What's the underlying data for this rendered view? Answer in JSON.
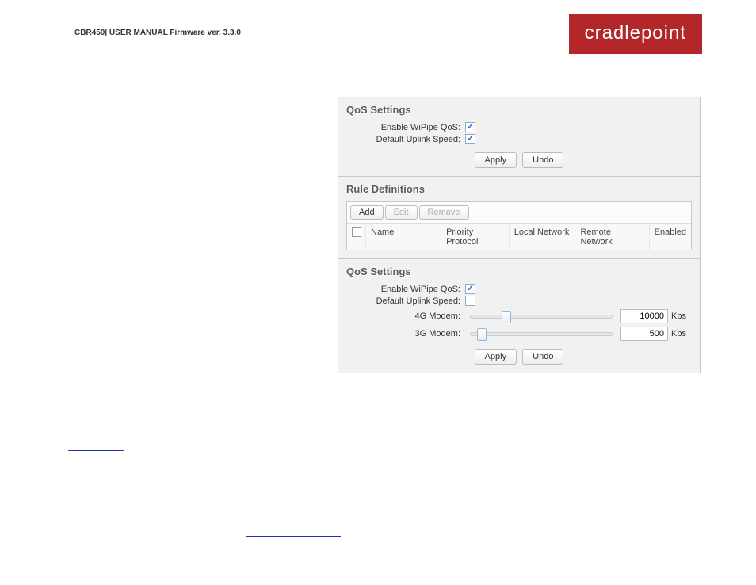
{
  "header": {
    "doc_title": "CBR450| USER MANUAL Firmware ver. 3.3.0",
    "logo_text": "cradlepoint"
  },
  "panel1": {
    "title": "QoS Settings",
    "enable_label": "Enable WiPipe QoS:",
    "default_label": "Default Uplink Speed:",
    "enable_checked": true,
    "default_checked": true,
    "apply_label": "Apply",
    "undo_label": "Undo"
  },
  "rules": {
    "title": "Rule Definitions",
    "add_label": "Add",
    "edit_label": "Edit",
    "remove_label": "Remove",
    "columns": {
      "name": "Name",
      "priority": "Priority Protocol",
      "local": "Local Network",
      "remote": "Remote Network",
      "enabled": "Enabled"
    }
  },
  "panel2": {
    "title": "QoS Settings",
    "enable_label": "Enable WiPipe QoS:",
    "default_label": "Default Uplink Speed:",
    "enable_checked": true,
    "default_checked": false,
    "modem4g_label": "4G Modem:",
    "modem4g_value": "10000",
    "modem4g_thumb_pct": 22,
    "modem3g_label": "3G Modem:",
    "modem3g_value": "500",
    "modem3g_thumb_pct": 5,
    "unit": "Kbs",
    "apply_label": "Apply",
    "undo_label": "Undo"
  }
}
